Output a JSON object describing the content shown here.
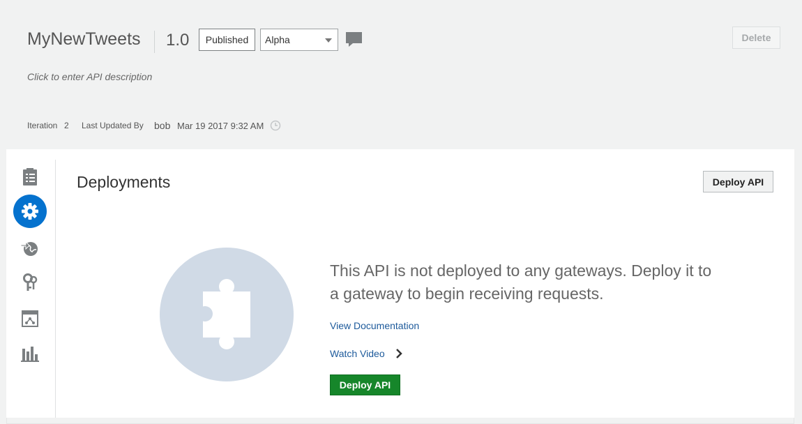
{
  "header": {
    "title": "MyNewTweets",
    "version": "1.0",
    "state_label": "Published",
    "select_value": "Alpha",
    "delete_label": "Delete",
    "description_placeholder": "Click to enter API description",
    "meta": {
      "iteration_label": "Iteration",
      "iteration_value": "2",
      "updated_by_label": "Last Updated By",
      "updated_by_value": "bob",
      "updated_at": "Mar 19 2017 9:32 AM"
    }
  },
  "sidebar": {
    "items": [
      {
        "icon": "checklist-icon"
      },
      {
        "icon": "gear-icon",
        "active": true
      },
      {
        "icon": "globe-arrow-icon"
      },
      {
        "icon": "keys-icon"
      },
      {
        "icon": "deployment-window-icon"
      },
      {
        "icon": "analytics-bars-icon"
      }
    ]
  },
  "main": {
    "section_title": "Deployments",
    "deploy_button_label": "Deploy API",
    "empty_state_message": "This API is not deployed to any gateways. Deploy it to a gateway to begin receiving requests.",
    "view_documentation_label": "View Documentation",
    "watch_video_label": "Watch Video",
    "primary_deploy_label": "Deploy API"
  },
  "colors": {
    "accent_blue": "#0572ce",
    "primary_green": "#16862a",
    "link_blue": "#1d5a9b",
    "placeholder_circle": "#d0dae6"
  }
}
